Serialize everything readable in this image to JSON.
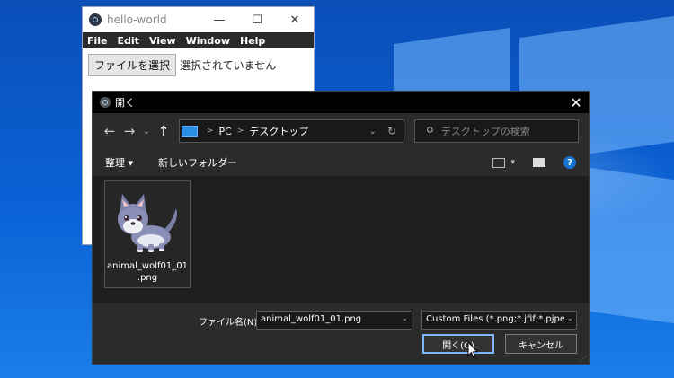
{
  "app_window": {
    "title": "hello-world",
    "caption": {
      "minimize": "—",
      "maximize": "☐",
      "close": "✕"
    },
    "menu": [
      "File",
      "Edit",
      "View",
      "Window",
      "Help"
    ],
    "file_button_label": "ファイルを選択",
    "file_status": "選択されていません"
  },
  "dialog": {
    "title": "開く",
    "close_glyph": "✕",
    "nav": {
      "back": "←",
      "forward": "→",
      "recent": "⌄",
      "up": "↑"
    },
    "address": {
      "segments": [
        "PC",
        "デスクトップ"
      ],
      "dropdown": "⌄",
      "refresh": "↻"
    },
    "search_placeholder": "デスクトップの検索",
    "toolbar": {
      "organize": "整理 ▾",
      "new_folder": "新しいフォルダー",
      "help": "?"
    },
    "files": [
      {
        "name_line1": "animal_wolf01_01",
        "name_line2": ".png",
        "icon": "wolf-thumbnail"
      }
    ],
    "filename_label": "ファイル名(N):",
    "filename_value": "animal_wolf01_01.png",
    "filetype_value": "Custom Files (*.png;*.jfif;*.pjpeg",
    "open_label": "開く(O)",
    "cancel_label": "キャンセル"
  },
  "colors": {
    "accent": "#7ab7ff",
    "dialog_bg": "#1e1e1e",
    "panel_bg": "#2b2b2b",
    "desktop": "#0a62d6"
  }
}
